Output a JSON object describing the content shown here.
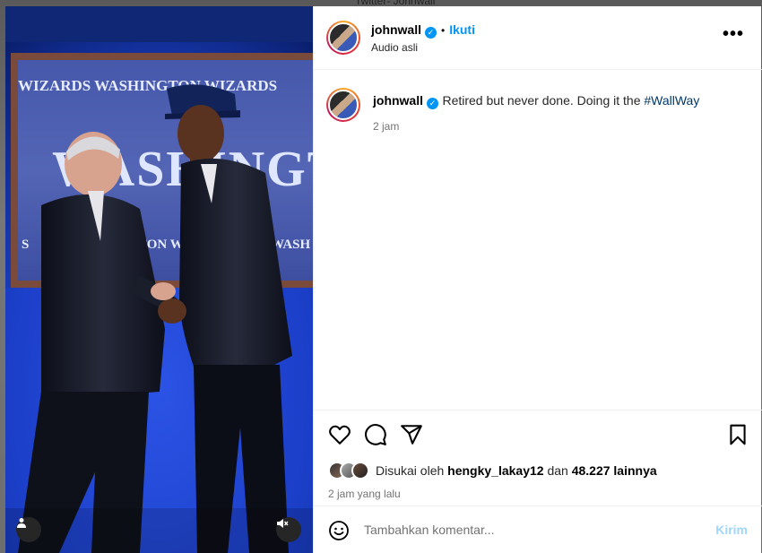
{
  "background": {
    "caption": "Twitter- Johnwall"
  },
  "post": {
    "author": {
      "username": "johnwall",
      "follow_label": "Ikuti",
      "dot": "•",
      "audio": "Audio asli",
      "more": "•••"
    },
    "media": {
      "banner_top": "WIZARDS   WASHINGTON WIZARDS",
      "banner_big": "WASHINGT",
      "banner_bottom_left": "S",
      "banner_bottom_mid": "TON WI",
      "banner_bottom_right": "WASH"
    },
    "caption": {
      "username": "johnwall",
      "text": "Retired but never done. Doing it the ",
      "hashtag": "#WallWay",
      "time": "2 jam"
    },
    "likes": {
      "prefix": "Disukai oleh ",
      "liker": "hengky_lakay12",
      "middle": " dan ",
      "count": "48.227 lainnya"
    },
    "time_ago": "2 jam yang lalu",
    "comment": {
      "placeholder": "Tambahkan komentar...",
      "post_label": "Kirim"
    }
  },
  "icons": {
    "tag": "person-icon",
    "mute": "speaker-muted-icon",
    "like": "heart-icon",
    "comment": "comment-bubble-icon",
    "share": "paper-plane-icon",
    "save": "bookmark-icon",
    "emoji": "smiley-icon",
    "verified": "verified-badge-icon",
    "more": "ellipsis-icon"
  },
  "colors": {
    "accent": "#0095f6",
    "link": "#00376b",
    "muted": "#737373",
    "post_disabled": "#9fd6fb",
    "media_bg": "#0e2a8a"
  }
}
